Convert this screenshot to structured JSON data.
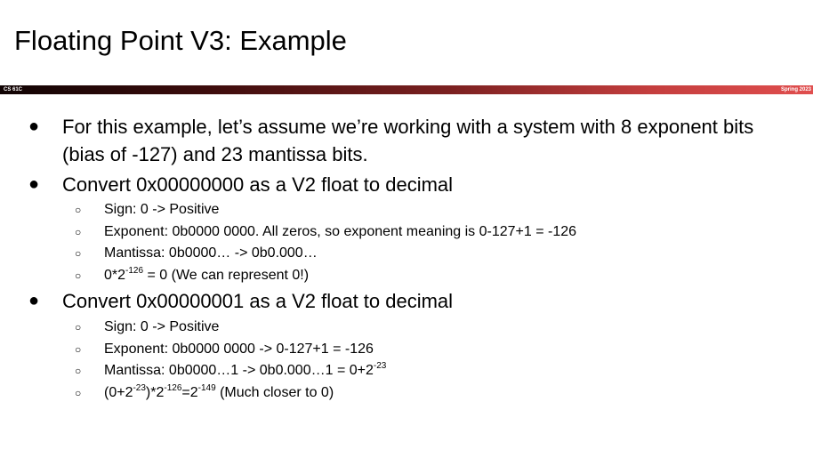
{
  "slide": {
    "title": "Floating Point V3: Example"
  },
  "banner": {
    "left_label": "CS 61C",
    "right_label": "Spring 2023"
  },
  "bullets": {
    "b1": {
      "text": "For this example, let’s assume we’re working with a system with 8 exponent bits (bias of -127) and 23 mantissa bits."
    },
    "b2": {
      "text": "Convert 0x00000000 as a V2 float to decimal",
      "sub1": "Sign: 0 -> Positive",
      "sub2": "Exponent: 0b0000 0000. All zeros, so exponent meaning is 0-127+1 = -126",
      "sub3": "Mantissa: 0b0000… -> 0b0.000…",
      "sub4": {
        "p1": "0*2",
        "sup1": "-126",
        "p2": " = 0 (We can represent 0!)"
      }
    },
    "b3": {
      "text": "Convert 0x00000001 as a V2 float to decimal",
      "sub1": "Sign: 0 -> Positive",
      "sub2": "Exponent: 0b0000 0000 -> 0-127+1 = -126",
      "sub3": {
        "p1": "Mantissa: 0b0000…1 -> 0b0.000…1 = 0+2",
        "sup1": "-23"
      },
      "sub4": {
        "p1": "(0+2",
        "sup1": "-23",
        "p2": ")*2",
        "sup2": "-126",
        "p3": "=2",
        "sup3": "-149",
        "p4": " (Much closer to 0)"
      }
    }
  },
  "symbols": {
    "bullet_l1": "●",
    "bullet_l2": "○"
  }
}
